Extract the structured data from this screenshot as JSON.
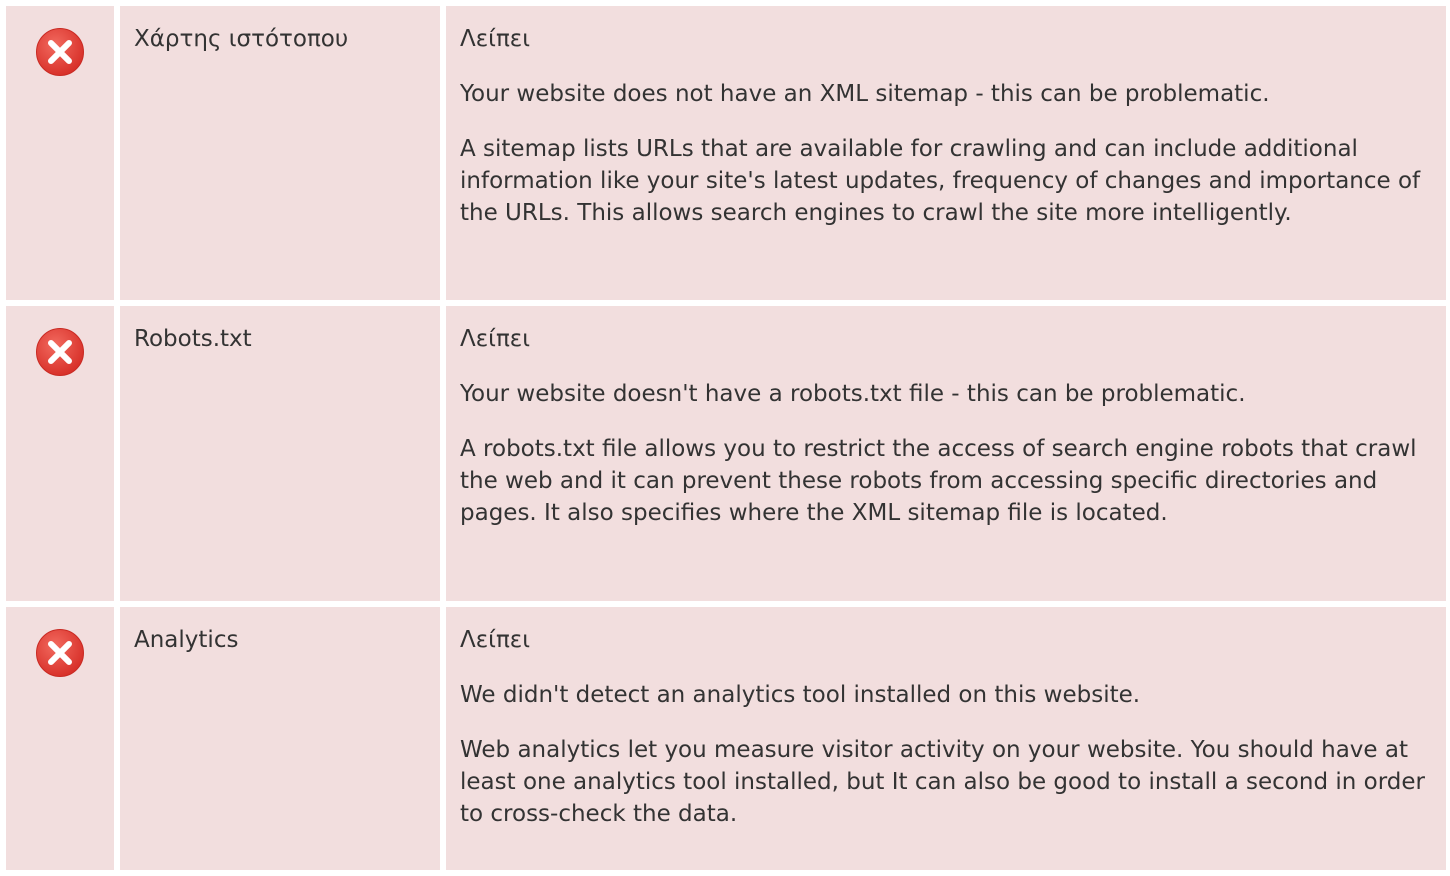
{
  "colors": {
    "row_bg": "#f2dede",
    "icon_red": "#e23d35",
    "text": "#333333"
  },
  "rows": [
    {
      "icon": "error-x-icon",
      "label": "Χάρτης ιστότοπου",
      "status": "Λείπει",
      "summary": "Your website does not have an XML sitemap - this can be problematic.",
      "detail": "A sitemap lists URLs that are available for crawling and can include additional information like your site's latest updates, frequency of changes and importance of the URLs. This allows search engines to crawl the site more intelligently."
    },
    {
      "icon": "error-x-icon",
      "label": "Robots.txt",
      "status": "Λείπει",
      "summary": "Your website doesn't have a robots.txt file - this can be problematic.",
      "detail": "A robots.txt file allows you to restrict the access of search engine robots that crawl the web and it can prevent these robots from accessing specific directories and pages. It also specifies where the XML sitemap file is located."
    },
    {
      "icon": "error-x-icon",
      "label": "Analytics",
      "status": "Λείπει",
      "summary": "We didn't detect an analytics tool installed on this website.",
      "detail": "Web analytics let you measure visitor activity on your website. You should have at least one analytics tool installed, but It can also be good to install a second in order to cross-check the data."
    }
  ]
}
